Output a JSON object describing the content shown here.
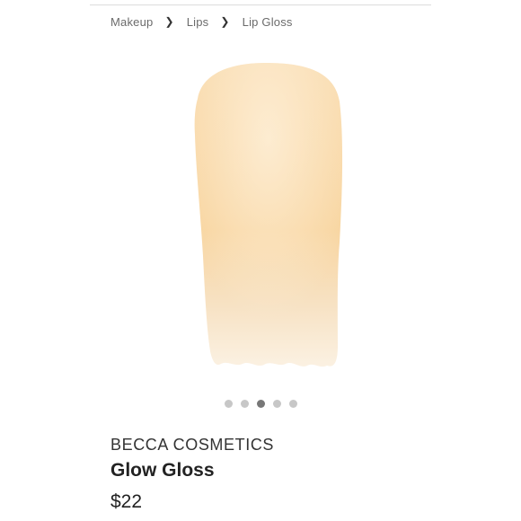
{
  "breadcrumb": {
    "items": [
      {
        "label": "Makeup"
      },
      {
        "label": "Lips"
      },
      {
        "label": "Lip Gloss"
      }
    ],
    "separator": "❯"
  },
  "gallery": {
    "image": "lip-gloss-swatch",
    "swatch_color": "#f8d9a8",
    "total_slides": 5,
    "active_slide": 3
  },
  "product": {
    "brand": "BECCA COSMETICS",
    "name": "Glow Gloss",
    "price": "$22"
  }
}
